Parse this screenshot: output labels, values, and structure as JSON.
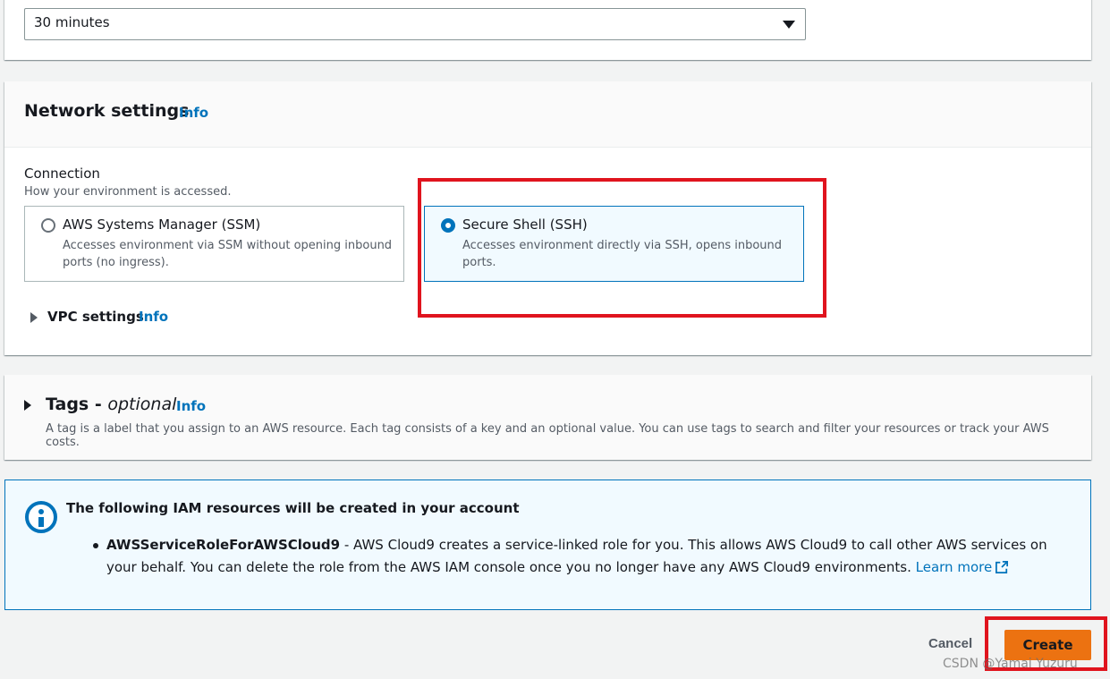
{
  "timeout": {
    "selected": "30 minutes"
  },
  "network": {
    "title": "Network settings",
    "info": "Info",
    "connection_label": "Connection",
    "connection_desc": "How your environment is accessed.",
    "options": [
      {
        "title": "AWS Systems Manager (SSM)",
        "desc": "Accesses environment via SSM without opening inbound ports (no ingress).",
        "selected": false
      },
      {
        "title": "Secure Shell (SSH)",
        "desc": "Accesses environment directly via SSH, opens inbound ports.",
        "selected": true
      }
    ],
    "vpc_label": "VPC settings",
    "vpc_info": "Info"
  },
  "tags": {
    "title_prefix": "Tags - ",
    "title_optional": "optional",
    "info": "Info",
    "desc": "A tag is a label that you assign to an AWS resource. Each tag consists of a key and an optional value. You can use tags to search and filter your resources or track your AWS costs."
  },
  "flash": {
    "title": "The following IAM resources will be created in your account",
    "role_name": "AWSServiceRoleForAWSCloud9",
    "text": " - AWS Cloud9 creates a service-linked role for you. This allows AWS Cloud9 to call other AWS services on your behalf. You can delete the role from the AWS IAM console once you no longer have any AWS Cloud9 environments. ",
    "learn_more": "Learn more"
  },
  "footer": {
    "cancel": "Cancel",
    "create": "Create"
  },
  "watermark": "CSDN @Yamai Yuzuru",
  "colors": {
    "accent": "#0073bb",
    "primary_button": "#ec7211",
    "highlight": "#e0141e"
  }
}
